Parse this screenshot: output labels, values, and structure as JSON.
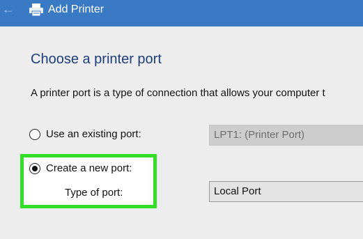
{
  "window": {
    "title": "Add Printer",
    "back_icon": "back-arrow-icon",
    "printer_icon": "printer-icon"
  },
  "page": {
    "heading": "Choose a printer port",
    "description": "A printer port is a type of connection that allows your computer t"
  },
  "options": {
    "existing_port": {
      "label": "Use an existing port:",
      "selected": false,
      "value": "LPT1: (Printer Port)",
      "enabled": false
    },
    "new_port": {
      "label": "Create a new port:",
      "selected": true,
      "type_label": "Type of port:",
      "value": "Local Port",
      "enabled": true
    }
  },
  "colors": {
    "titlebar": "#3a79c4",
    "heading": "#1f3d7a",
    "highlight_border": "#33dd2a"
  }
}
